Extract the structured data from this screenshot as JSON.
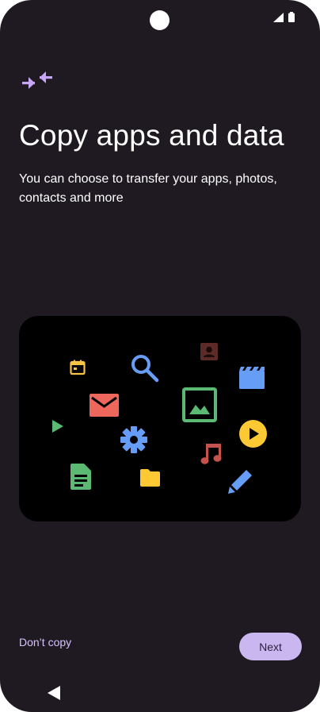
{
  "screen": {
    "title": "Copy apps and data",
    "subtitle": "You can choose to transfer your apps, photos, contacts and more"
  },
  "buttons": {
    "dont_copy": "Don’t copy",
    "next": "Next"
  },
  "icons": [
    "transfer-icon",
    "calendar-icon",
    "search-icon",
    "contact-icon",
    "video-clapper-icon",
    "mail-icon",
    "image-icon",
    "play-icon",
    "settings-gear-icon",
    "play-circle-icon",
    "music-note-icon",
    "document-icon",
    "folder-icon",
    "pencil-icon",
    "nav-back-icon"
  ],
  "colors": {
    "background": "#1f1a21",
    "accent": "#cbb7f0",
    "text": "#ffffff"
  }
}
